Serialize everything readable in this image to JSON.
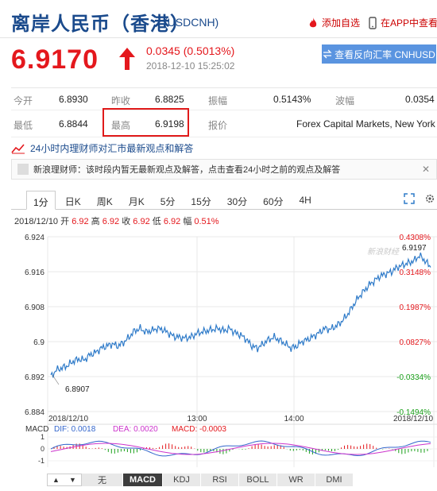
{
  "header": {
    "title": "离岸人民币（香港）",
    "symbol": "(USDCNH)",
    "add_watchlist": "添加自选",
    "view_in_app": "在APP中查看"
  },
  "quote": {
    "price": "6.9170",
    "change": "0.0345 (0.5013%)",
    "timestamp": "2018-12-10 15:25:02",
    "reverse_btn": "查看反向汇率 CNHUSD"
  },
  "stats": {
    "open_label": "今开",
    "open": "6.8930",
    "prev_close_label": "昨收",
    "prev_close": "6.8825",
    "amplitude_label": "振幅",
    "amplitude": "0.5143%",
    "wave_label": "波幅",
    "wave": "0.0354",
    "low_label": "最低",
    "low": "6.8844",
    "high_label": "最高",
    "high": "6.9198",
    "quote_label": "报价",
    "quote_source": "Forex Capital Markets, New York"
  },
  "news": {
    "heading": "24小时内理财师对汇市最新观点和解答",
    "text": "新浪理财师：该时段内暂无最新观点及解答，点击查看24小时之前的观点及解答"
  },
  "tabs": [
    "1分",
    "日K",
    "周K",
    "月K",
    "5分",
    "15分",
    "30分",
    "60分",
    "4H"
  ],
  "ohlc": {
    "date": "2018/12/10",
    "open_label": "开",
    "open": "6.92",
    "high_label": "高",
    "high": "6.92",
    "close_label": "收",
    "close": "6.92",
    "low_label": "低",
    "low": "6.92",
    "amp_label": "幅",
    "amp": "0.51%"
  },
  "watermark": "新浪财经",
  "chart_data": {
    "type": "line",
    "x_ticks": [
      "2018/12/10",
      "13:00",
      "14:00",
      "2018/12/10"
    ],
    "y_ticks": [
      "6.924",
      "6.916",
      "6.908",
      "6.9",
      "6.892",
      "6.884"
    ],
    "y_pct_ticks": [
      "0.4308%",
      "0.3148%",
      "0.1987%",
      "0.0827%",
      "-0.0334%",
      "-0.1494%"
    ],
    "ylim": [
      6.884,
      6.924
    ],
    "annotations": {
      "max": "6.9197",
      "min": "6.8907"
    },
    "series": [
      {
        "values": [
          6.892,
          6.8935,
          6.894,
          6.8945,
          6.8955,
          6.896,
          6.8958,
          6.897,
          6.8975,
          6.8985,
          6.899,
          6.8995,
          6.899,
          6.8998,
          6.901,
          6.9025,
          6.903,
          6.9022,
          6.9025,
          6.903,
          6.9028,
          6.902,
          6.9012,
          6.901,
          6.9008,
          6.901,
          6.9018,
          6.9022,
          6.9025,
          6.9028,
          6.903,
          6.9025,
          6.903,
          6.902,
          6.9015,
          6.9005,
          6.899,
          6.8985,
          6.8995,
          6.9005,
          6.901,
          6.9003,
          6.8995,
          6.8985,
          6.899,
          6.9,
          6.9005,
          6.9012,
          6.902,
          6.903,
          6.9028,
          6.9035,
          6.9045,
          6.906,
          6.908,
          6.91,
          6.9115,
          6.913,
          6.914,
          6.915,
          6.9155,
          6.916,
          6.917,
          6.9175,
          6.918,
          6.9185,
          6.9197,
          6.9185,
          6.917
        ]
      }
    ]
  },
  "macd": {
    "name": "MACD",
    "dif_label": "DIF: 0.0018",
    "dea_label": "DEA: 0.0020",
    "macd_label": "MACD: -0.0003",
    "y_ticks": [
      "1",
      "0",
      "-1"
    ],
    "colors": {
      "dif": "#3366cc",
      "dea": "#cc33cc",
      "macd": "#e4181d"
    }
  },
  "indicators": [
    "无",
    "MACD",
    "KDJ",
    "RSI",
    "BOLL",
    "WR",
    "DMI"
  ],
  "colors": {
    "up": "#e4181d",
    "down": "#1aa01a",
    "line": "#2f7bc9",
    "title": "#1a4a8c"
  }
}
